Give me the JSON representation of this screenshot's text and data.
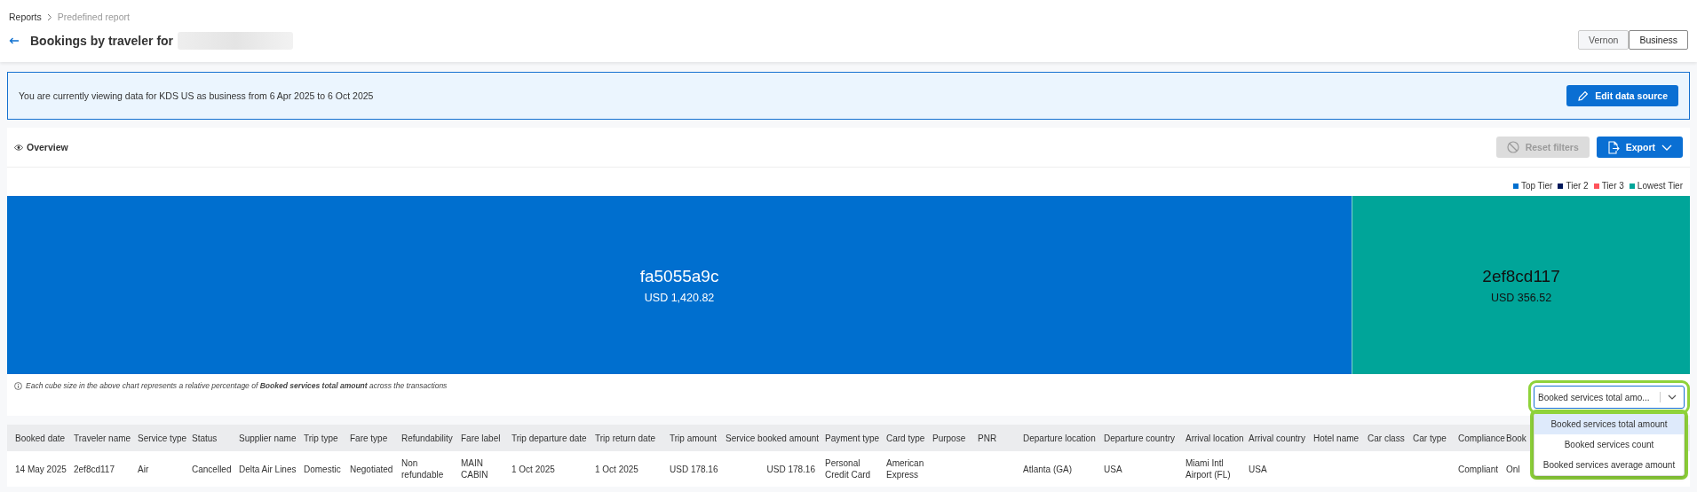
{
  "breadcrumb": [
    {
      "label": "Reports",
      "current": false
    },
    {
      "label": "Predefined report",
      "current": true
    }
  ],
  "title": "Bookings by traveler for",
  "view_toggle": [
    {
      "label": "Vernon",
      "selected": false
    },
    {
      "label": "Business",
      "selected": true
    }
  ],
  "banner": {
    "text": "You are currently viewing data for KDS US as business from 6 Apr 2025 to 6 Oct 2025",
    "button": "Edit data source"
  },
  "overview": {
    "title": "Overview",
    "reset_button": {
      "label": "Reset filters",
      "disabled": true
    },
    "export_button": "Export"
  },
  "legend": [
    {
      "label": "Top Tier",
      "color": "#006fcf"
    },
    {
      "label": "Tier 2",
      "color": "#00175a"
    },
    {
      "label": "Tier 3",
      "color": "#ff535a"
    },
    {
      "label": "Lowest Tier",
      "color": "#00a599"
    }
  ],
  "treemap": [
    {
      "label": "fa5055a9c",
      "amount": "USD 1,420.82",
      "color": "#006fcf",
      "dark_text": false
    },
    {
      "label": "2ef8cd117",
      "amount": "USD 356.52",
      "color": "#00a599",
      "dark_text": true
    }
  ],
  "note": {
    "text": "*Each cube size in the above chart represents a relative percentage of* **Booked services total amount** *across the transactions*"
  },
  "metric_select": {
    "value": "Booked services total amo...",
    "options": [
      {
        "label": "Booked services total amount",
        "selected": true
      },
      {
        "label": "Booked services count",
        "selected": false
      },
      {
        "label": "Booked services average amount",
        "selected": false
      }
    ]
  },
  "table": {
    "columns": [
      "Booked date",
      "Traveler name",
      "Service type",
      "Status",
      "Supplier name",
      "Trip type",
      "Fare type",
      "Refundability",
      "Fare label",
      "Trip departure date",
      "Trip return date",
      "Trip amount",
      "Service booked amount",
      "Payment type",
      "Card type",
      "Purpose",
      "PNR",
      "Departure location",
      "Departure country",
      "Arrival location",
      "Arrival country",
      "Hotel name",
      "Car class",
      "Car type",
      "Compliance",
      "Book"
    ],
    "rows": [
      [
        "14 May 2025",
        "2ef8cd117",
        "Air",
        "Cancelled",
        "Delta Air Lines",
        "Domestic",
        "Negotiated",
        "Non refundable",
        "MAIN CABIN",
        "1 Oct 2025",
        "1 Oct 2025",
        "USD 178.16",
        "USD 178.16",
        "Personal Credit Card",
        "American Express",
        "",
        "",
        "Atlanta (GA)",
        "USA",
        "Miami Intl Airport (FL)",
        "USA",
        "",
        "",
        "",
        "Compliant",
        "Onl"
      ]
    ]
  }
}
